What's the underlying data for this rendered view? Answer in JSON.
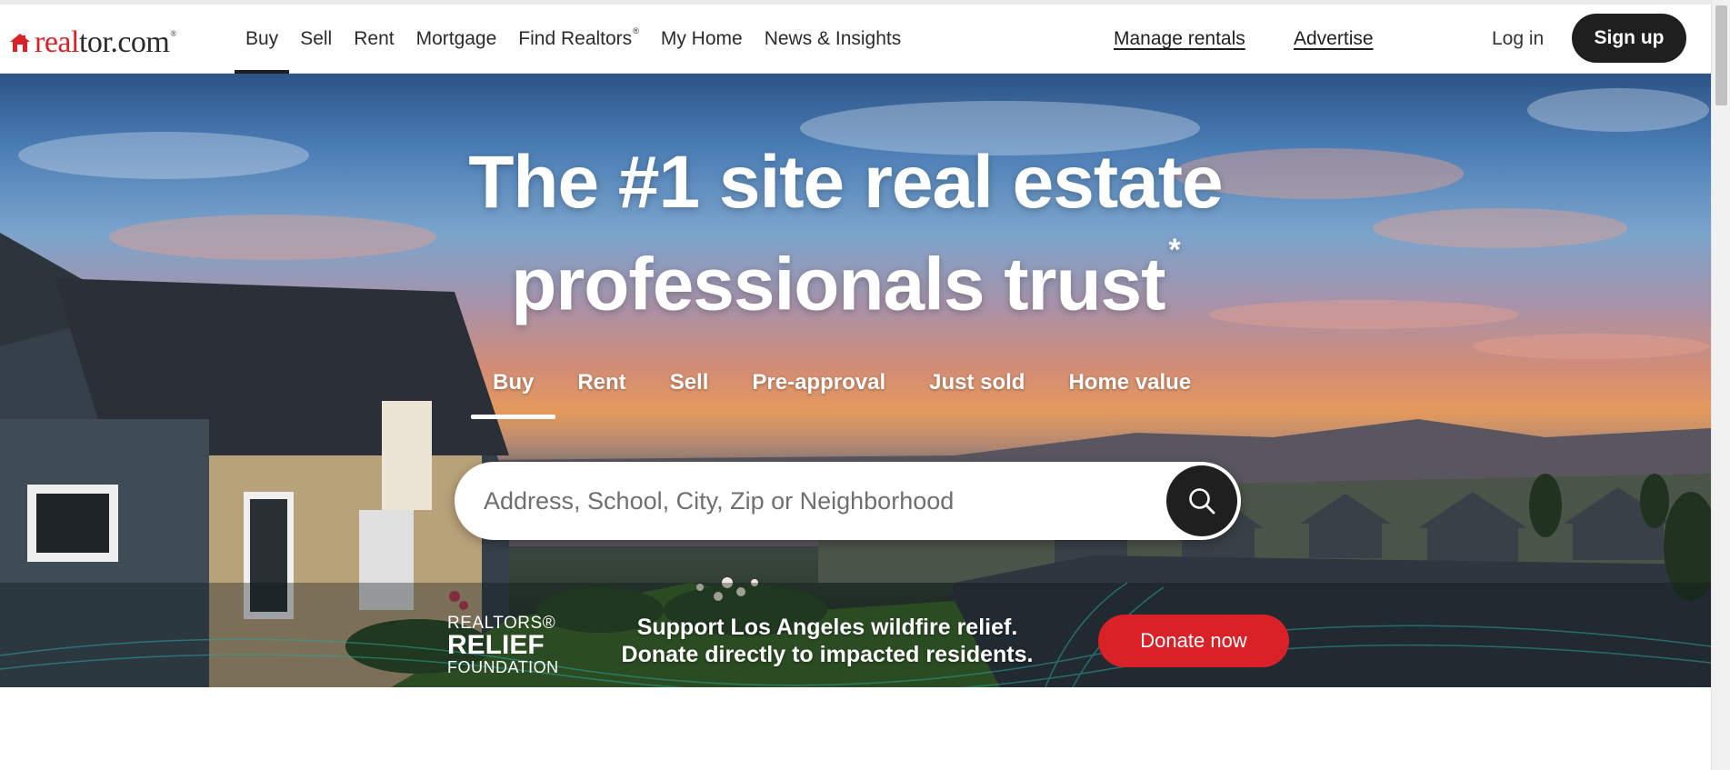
{
  "brand": {
    "logo_real": "real",
    "logo_tor": "tor.com",
    "logo_reg": "®",
    "accent_color": "#d92228"
  },
  "nav": {
    "items": [
      {
        "label": "Buy",
        "active": true
      },
      {
        "label": "Sell"
      },
      {
        "label": "Rent"
      },
      {
        "label": "Mortgage"
      },
      {
        "label": "Find Realtors",
        "sup": "®"
      },
      {
        "label": "My Home"
      },
      {
        "label": "News & Insights"
      }
    ],
    "manage_rentals": "Manage rentals",
    "advertise": "Advertise",
    "login": "Log in",
    "signup": "Sign up"
  },
  "hero": {
    "headline_line1": "The #1 site real estate",
    "headline_line2": "professionals trust",
    "headline_asterisk": "*",
    "tabs": [
      {
        "label": "Buy",
        "active": true
      },
      {
        "label": "Rent"
      },
      {
        "label": "Sell"
      },
      {
        "label": "Pre-approval"
      },
      {
        "label": "Just sold"
      },
      {
        "label": "Home value"
      }
    ],
    "search": {
      "placeholder": "Address, School, City, Zip or Neighborhood",
      "icon": "search-icon"
    }
  },
  "relief": {
    "logo_line1": "REALTORS®",
    "logo_line2": "RELIEF",
    "logo_line3": "FOUNDATION",
    "message_line1": "Support Los Angeles wildfire relief.",
    "message_line2": "Donate directly to impacted residents.",
    "donate_label": "Donate now"
  }
}
